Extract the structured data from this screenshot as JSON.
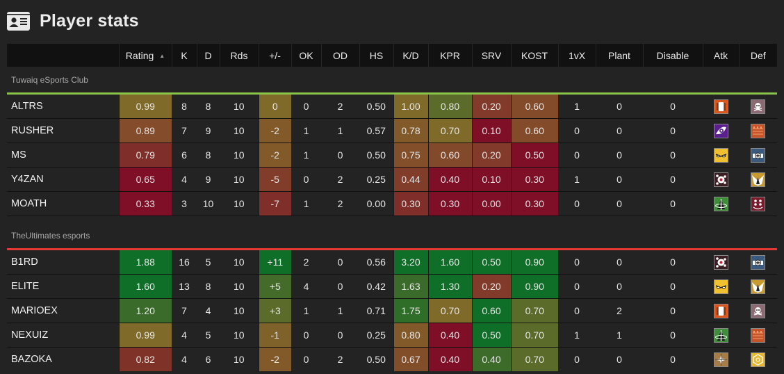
{
  "page": {
    "title": "Player stats",
    "title_icon": "id-card-icon"
  },
  "columns": [
    {
      "key": "name",
      "label": ""
    },
    {
      "key": "rating",
      "label": "Rating",
      "sorted": "ascending"
    },
    {
      "key": "k",
      "label": "K"
    },
    {
      "key": "d",
      "label": "D"
    },
    {
      "key": "rds",
      "label": "Rds"
    },
    {
      "key": "pm",
      "label": "+/-"
    },
    {
      "key": "ok",
      "label": "OK"
    },
    {
      "key": "od",
      "label": "OD"
    },
    {
      "key": "hs",
      "label": "HS"
    },
    {
      "key": "kd",
      "label": "K/D"
    },
    {
      "key": "kpr",
      "label": "KPR"
    },
    {
      "key": "srv",
      "label": "SRV"
    },
    {
      "key": "kost",
      "label": "KOST"
    },
    {
      "key": "onevx",
      "label": "1vX"
    },
    {
      "key": "plant",
      "label": "Plant"
    },
    {
      "key": "disable",
      "label": "Disable"
    },
    {
      "key": "atk",
      "label": "Atk"
    },
    {
      "key": "def",
      "label": "Def"
    }
  ],
  "heat_colors": {
    "green": "#0f6e28",
    "green_mid": "#3a6b2a",
    "olive": "#5a6b2a",
    "yellow": "#7f6a2a",
    "orange": "#824e2a",
    "rust": "#7f3328",
    "red": "#7e0f27"
  },
  "teams": [
    {
      "name": "Tuwaiq eSports Club",
      "accent": "#8bc34a",
      "players": [
        {
          "name": "ALTRS",
          "rating": "0.99",
          "k": "8",
          "d": "8",
          "rds": "10",
          "pm": "0",
          "ok": "0",
          "od": "2",
          "hs": "0.50",
          "kd": "1.00",
          "kpr": "0.80",
          "srv": "0.20",
          "kost": "0.60",
          "onevx": "1",
          "plant": "0",
          "disable": "0",
          "colors": {
            "rating": "#7f6a2a",
            "pm": "#7f6a2a",
            "kd": "#7f6a2a",
            "kpr": "#5a6b2a",
            "srv": "#823b2a",
            "kost": "#844b2a"
          },
          "atk": "orange-shield-operator-icon",
          "def": "skull-gas-operator-icon"
        },
        {
          "name": "RUSHER",
          "rating": "0.89",
          "k": "7",
          "d": "9",
          "rds": "10",
          "pm": "-2",
          "ok": "1",
          "od": "1",
          "hs": "0.57",
          "kd": "0.78",
          "kpr": "0.70",
          "srv": "0.10",
          "kost": "0.60",
          "onevx": "0",
          "plant": "0",
          "disable": "0",
          "colors": {
            "rating": "#844c2a",
            "pm": "#825a2a",
            "kd": "#825a2a",
            "kpr": "#7f6a2a",
            "srv": "#7e0f27",
            "kost": "#844b2a"
          },
          "atk": "purple-eye-operator-icon",
          "def": "orange-wall-operator-icon"
        },
        {
          "name": "MS",
          "rating": "0.79",
          "k": "6",
          "d": "8",
          "rds": "10",
          "pm": "-2",
          "ok": "1",
          "od": "0",
          "hs": "0.50",
          "kd": "0.75",
          "kpr": "0.60",
          "srv": "0.20",
          "kost": "0.50",
          "onevx": "0",
          "plant": "0",
          "disable": "0",
          "colors": {
            "rating": "#7f2e29",
            "pm": "#825a2a",
            "kd": "#824f2a",
            "kpr": "#824a2a",
            "srv": "#823b2a",
            "kost": "#7e0f27"
          },
          "atk": "yellow-eyes-operator-icon",
          "def": "blue-medic-operator-icon"
        },
        {
          "name": "Y4ZAN",
          "rating": "0.65",
          "k": "4",
          "d": "9",
          "rds": "10",
          "pm": "-5",
          "ok": "0",
          "od": "2",
          "hs": "0.25",
          "kd": "0.44",
          "kpr": "0.40",
          "srv": "0.10",
          "kost": "0.30",
          "onevx": "1",
          "plant": "0",
          "disable": "0",
          "colors": {
            "rating": "#7e0f27",
            "pm": "#823d2a",
            "kd": "#823c2a",
            "kpr": "#7e0f27",
            "srv": "#7e0f27",
            "kost": "#7e0f27"
          },
          "atk": "red-burst-operator-icon",
          "def": "winged-operator-icon"
        },
        {
          "name": "MOATH",
          "rating": "0.33",
          "k": "3",
          "d": "10",
          "rds": "10",
          "pm": "-7",
          "ok": "1",
          "od": "2",
          "hs": "0.00",
          "kd": "0.30",
          "kpr": "0.30",
          "srv": "0.00",
          "kost": "0.30",
          "onevx": "0",
          "plant": "0",
          "disable": "0",
          "colors": {
            "rating": "#7e0f27",
            "pm": "#7f2e29",
            "kd": "#7f2e29",
            "kpr": "#7e0f27",
            "srv": "#7e0f27",
            "kost": "#7e0f27"
          },
          "atk": "green-arrow-operator-icon",
          "def": "drone-dots-operator-icon"
        }
      ]
    },
    {
      "name": "TheUltimates esports",
      "accent": "#e53935",
      "players": [
        {
          "name": "B1RD",
          "rating": "1.88",
          "k": "16",
          "d": "5",
          "rds": "10",
          "pm": "+11",
          "ok": "2",
          "od": "0",
          "hs": "0.56",
          "kd": "3.20",
          "kpr": "1.60",
          "srv": "0.50",
          "kost": "0.90",
          "onevx": "0",
          "plant": "0",
          "disable": "0",
          "colors": {
            "rating": "#0f6e28",
            "pm": "#0f6e28",
            "kd": "#0f6e28",
            "kpr": "#0f6e28",
            "srv": "#0f6e28",
            "kost": "#0f6e28"
          },
          "atk": "red-burst-operator-icon",
          "def": "blue-medic-operator-icon"
        },
        {
          "name": "ELITE",
          "rating": "1.60",
          "k": "13",
          "d": "8",
          "rds": "10",
          "pm": "+5",
          "ok": "4",
          "od": "0",
          "hs": "0.42",
          "kd": "1.63",
          "kpr": "1.30",
          "srv": "0.20",
          "kost": "0.90",
          "onevx": "0",
          "plant": "0",
          "disable": "0",
          "colors": {
            "rating": "#0f6e28",
            "pm": "#456b2a",
            "kd": "#3a6b2a",
            "kpr": "#0f6e28",
            "srv": "#823b2a",
            "kost": "#0f6e28"
          },
          "atk": "yellow-eyes-operator-icon",
          "def": "winged-operator-icon"
        },
        {
          "name": "MARIOEX",
          "rating": "1.20",
          "k": "7",
          "d": "4",
          "rds": "10",
          "pm": "+3",
          "ok": "1",
          "od": "1",
          "hs": "0.71",
          "kd": "1.75",
          "kpr": "0.70",
          "srv": "0.60",
          "kost": "0.70",
          "onevx": "0",
          "plant": "2",
          "disable": "0",
          "colors": {
            "rating": "#3a6b2a",
            "pm": "#5a6b2a",
            "kd": "#2f6e28",
            "kpr": "#7f6a2a",
            "srv": "#0f6e28",
            "kost": "#5a6b2a"
          },
          "atk": "orange-shield-operator-icon",
          "def": "skull-gas-operator-icon"
        },
        {
          "name": "NEXUIZ",
          "rating": "0.99",
          "k": "4",
          "d": "5",
          "rds": "10",
          "pm": "-1",
          "ok": "0",
          "od": "0",
          "hs": "0.25",
          "kd": "0.80",
          "kpr": "0.40",
          "srv": "0.50",
          "kost": "0.70",
          "onevx": "1",
          "plant": "1",
          "disable": "0",
          "colors": {
            "rating": "#7f6a2a",
            "pm": "#7f622a",
            "kd": "#825a2a",
            "kpr": "#7e0f27",
            "srv": "#0f6e28",
            "kost": "#5a6b2a"
          },
          "atk": "green-arrow-operator-icon",
          "def": "orange-wall-operator-icon"
        },
        {
          "name": "BAZOKA",
          "rating": "0.82",
          "k": "4",
          "d": "6",
          "rds": "10",
          "pm": "-2",
          "ok": "0",
          "od": "2",
          "hs": "0.50",
          "kd": "0.67",
          "kpr": "0.40",
          "srv": "0.40",
          "kost": "0.70",
          "onevx": "0",
          "plant": "0",
          "disable": "0",
          "colors": {
            "rating": "#7f3328",
            "pm": "#825a2a",
            "kd": "#824e2a",
            "kpr": "#7e0f27",
            "srv": "#3d6b2a",
            "kost": "#5a6b2a"
          },
          "atk": "compass-star-operator-icon",
          "def": "gold-hex-operator-icon"
        }
      ]
    }
  ]
}
